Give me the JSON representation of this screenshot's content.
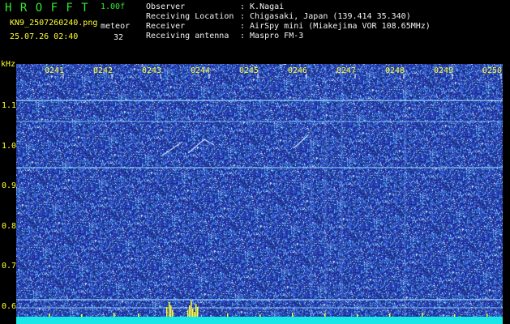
{
  "header": {
    "brand": "H R O F F T",
    "version": "1.00f",
    "filename": "KN9_2507260240.png",
    "mode_label": "meteor",
    "datetime": "25.07.26 02:40",
    "count": "32"
  },
  "info": [
    {
      "key": "Observer",
      "value": ": K.Nagai"
    },
    {
      "key": "Receiving Location",
      "value": ": Chigasaki, Japan (139.414 35.340)"
    },
    {
      "key": "Receiver",
      "value": ": AirSpy mini (Miakejima VOR 108.65MHz)"
    },
    {
      "key": "Receiving antenna",
      "value": ": Maspro FM-3"
    }
  ],
  "spectrogram": {
    "unit": "kHz",
    "x_labels": [
      "0241",
      "0242",
      "0243",
      "0244",
      "0245",
      "0246",
      "0247",
      "0248",
      "0249",
      "0250"
    ],
    "y_labels": [
      "1.1",
      "1.0",
      "0.9",
      "0.8",
      "0.7",
      "0.6"
    ],
    "colors": {
      "background": "#1c2a95",
      "text": "#ffff33",
      "baseline": "#19e6e6",
      "spike": "#ffff33"
    }
  }
}
